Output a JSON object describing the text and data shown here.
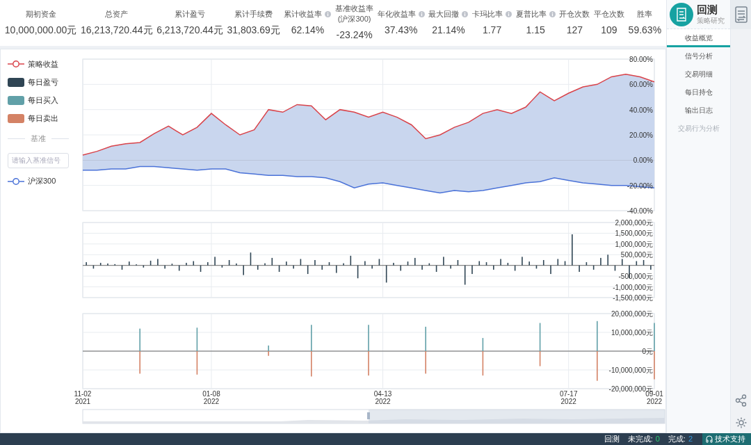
{
  "stats": [
    {
      "label": "期初资金",
      "value": "10,000,000.00元"
    },
    {
      "label": "总资产",
      "value": "16,213,720.44元"
    },
    {
      "label": "累计盈亏",
      "value": "6,213,720.44元"
    },
    {
      "label": "累计手续费",
      "value": "31,803.69元"
    },
    {
      "label": "累计收益率",
      "info": true,
      "value": "62.14%"
    },
    {
      "label": "基准收益率",
      "sublabel": "(沪深300)",
      "value": "-23.24%"
    },
    {
      "label": "年化收益率",
      "info": true,
      "value": "37.43%"
    },
    {
      "label": "最大回撤",
      "info": true,
      "value": "21.14%"
    },
    {
      "label": "卡玛比率",
      "info": true,
      "value": "1.77"
    },
    {
      "label": "夏普比率",
      "info": true,
      "value": "1.15"
    },
    {
      "label": "开仓次数",
      "value": "127"
    },
    {
      "label": "平仓次数",
      "value": "109"
    },
    {
      "label": "胜率",
      "value": "59.63%"
    }
  ],
  "legend": [
    {
      "kind": "line",
      "label": "策略收益",
      "color": "#d9434a"
    },
    {
      "kind": "swatch",
      "label": "每日盈亏",
      "color": "#2f4554"
    },
    {
      "kind": "swatch",
      "label": "每日买入",
      "color": "#61a0a8"
    },
    {
      "kind": "swatch",
      "label": "每日卖出",
      "color": "#d48265"
    }
  ],
  "benchmark": {
    "heading": "基准",
    "placeholder": "请输入基准信号",
    "items": [
      {
        "kind": "line",
        "label": "沪深300",
        "color": "#4a72d8"
      }
    ]
  },
  "charts": [
    {
      "chart_data": {
        "type": "area",
        "grid": true,
        "ylim": [
          -40,
          80
        ],
        "yticks": [
          {
            "value": 80,
            "label": "80.00%"
          },
          {
            "value": 60,
            "label": "60.00%"
          },
          {
            "value": 40,
            "label": "40.00%"
          },
          {
            "value": 20,
            "label": "20.00%"
          },
          {
            "value": 0,
            "label": "0.00%"
          },
          {
            "value": -20,
            "label": "-20.00%"
          },
          {
            "value": -40,
            "label": "-40.00%"
          }
        ],
        "series": [
          {
            "color": "#d9434a",
            "values": [
              4,
              7,
              11,
              13,
              14,
              21,
              27,
              20,
              26,
              37,
              28,
              20,
              24,
              40,
              38,
              44,
              43,
              32,
              40,
              38,
              34,
              38,
              34,
              28,
              17,
              20,
              26,
              30,
              37,
              40,
              37,
              42,
              54,
              47,
              53,
              58,
              60,
              66,
              68,
              66,
              62
            ]
          },
          {
            "color": "#4a72d8",
            "values": [
              -8,
              -8,
              -7,
              -7,
              -5,
              -5,
              -6,
              -7,
              -8,
              -7,
              -7,
              -10,
              -11,
              -12,
              -12,
              -13,
              -13,
              -14,
              -17,
              -22,
              -19,
              -18,
              -20,
              -22,
              -24,
              -26,
              -24,
              -25,
              -24,
              -22,
              -20,
              -18,
              -17,
              -14,
              -16,
              -18,
              -19,
              -20,
              -20,
              -21,
              -22
            ]
          }
        ]
      }
    },
    {
      "chart_data": {
        "type": "bar",
        "grid": true,
        "ylim": [
          -1500000,
          2000000
        ],
        "yticks": [
          {
            "value": 2000000,
            "label": "2,000,000元"
          },
          {
            "value": 1500000,
            "label": "1,500,000元"
          },
          {
            "value": 1000000,
            "label": "1,000,000元"
          },
          {
            "value": 500000,
            "label": "500,000元"
          },
          {
            "value": -500000,
            "label": "-500,000元"
          },
          {
            "value": -1000000,
            "label": "-1,000,000元"
          },
          {
            "value": -1500000,
            "label": "-1,500,000元"
          }
        ],
        "series": [
          {
            "color": "#2f4554",
            "values": [
              150000,
              -150000,
              120000,
              90000,
              60000,
              -200000,
              180000,
              50000,
              -100000,
              220000,
              300000,
              -150000,
              80000,
              -250000,
              120000,
              200000,
              -300000,
              150000,
              400000,
              -100000,
              250000,
              90000,
              -450000,
              600000,
              -200000,
              100000,
              350000,
              -300000,
              180000,
              -150000,
              300000,
              -400000,
              250000,
              -200000,
              150000,
              -350000,
              100000,
              450000,
              -600000,
              200000,
              -150000,
              300000,
              -800000,
              120000,
              -250000,
              180000,
              350000,
              -200000,
              100000,
              -300000,
              400000,
              -150000,
              250000,
              -900000,
              -400000,
              200000,
              150000,
              -200000,
              300000,
              120000,
              -250000,
              400000,
              180000,
              -150000,
              250000,
              -400000,
              300000,
              200000,
              1450000,
              -300000,
              150000,
              -200000,
              350000,
              500000,
              -250000,
              300000,
              -600000,
              200000,
              250000,
              -200000
            ]
          }
        ]
      }
    },
    {
      "chart_data": {
        "type": "bar",
        "grid": true,
        "ylim": [
          -20000000,
          20000000
        ],
        "yticks": [
          {
            "value": 20000000,
            "label": "20,000,000元"
          },
          {
            "value": 10000000,
            "label": "10,000,000元"
          },
          {
            "value": 0,
            "label": "0元"
          },
          {
            "value": -10000000,
            "label": "-10,000,000元"
          },
          {
            "value": -20000000,
            "label": "-20,000,000元"
          }
        ],
        "categories": [
          "11-02 2021",
          null,
          null,
          null,
          null,
          null,
          null,
          null,
          null,
          "01-08 2022",
          null,
          null,
          null,
          null,
          null,
          null,
          null,
          null,
          null,
          null,
          null,
          "04-13 2022",
          null,
          null,
          null,
          null,
          null,
          null,
          null,
          null,
          null,
          null,
          null,
          null,
          "07-17 2022",
          null,
          null,
          null,
          null,
          null,
          "09-01 2022"
        ],
        "series": [
          {
            "color": "#61a0a8",
            "values": [
              null,
              null,
              null,
              null,
              12000000,
              null,
              null,
              null,
              12500000,
              null,
              null,
              null,
              null,
              3000000,
              null,
              null,
              14000000,
              null,
              null,
              null,
              14000000,
              null,
              null,
              null,
              13000000,
              null,
              null,
              null,
              7000000,
              null,
              null,
              null,
              15000000,
              null,
              null,
              null,
              16000000,
              null,
              null,
              null,
              15000000
            ]
          },
          {
            "color": "#d48265",
            "values": [
              null,
              null,
              null,
              null,
              -12000000,
              null,
              null,
              null,
              -12500000,
              null,
              null,
              null,
              null,
              -2500000,
              null,
              null,
              -13500000,
              null,
              null,
              null,
              -13000000,
              null,
              null,
              null,
              -12000000,
              null,
              null,
              null,
              -13000000,
              null,
              null,
              null,
              -8000000,
              null,
              null,
              null,
              -15800000,
              null,
              null,
              null,
              -15000000
            ]
          }
        ]
      }
    }
  ],
  "navigator": {
    "level": 0.5
  },
  "sidebar": {
    "title": "回测",
    "subtitle": "策略研究",
    "tabs": [
      {
        "label": "收益概览",
        "selected": true,
        "disabled": false
      },
      {
        "label": "信号分析",
        "selected": false,
        "disabled": false
      },
      {
        "label": "交易明细",
        "selected": false,
        "disabled": false
      },
      {
        "label": "每日持仓",
        "selected": false,
        "disabled": false
      },
      {
        "label": "输出日志",
        "selected": false,
        "disabled": false
      },
      {
        "label": "交易行为分析",
        "selected": false,
        "disabled": true
      }
    ]
  },
  "status_bar": {
    "mode": "回测",
    "pending_label": "未完成:",
    "pending": "0",
    "done_label": "完成:",
    "done": "2",
    "support": "技术支持"
  }
}
